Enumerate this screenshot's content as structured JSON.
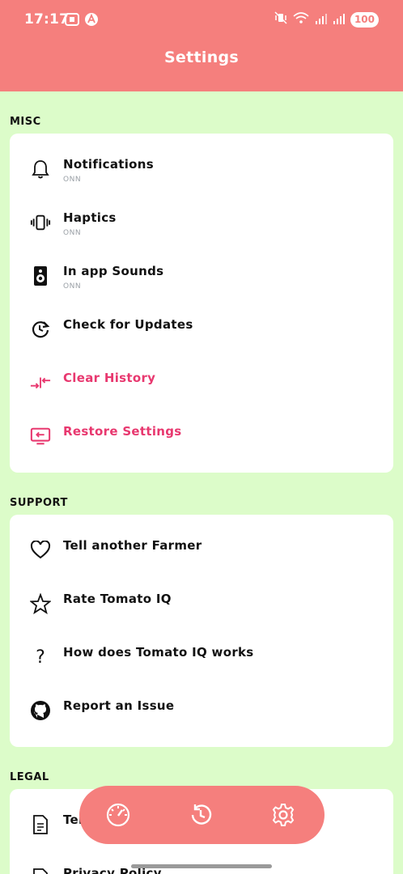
{
  "status_bar": {
    "time": "17:17",
    "battery": "100",
    "icons_left": [
      "screenshot-icon",
      "a-badge-icon"
    ],
    "icons_right": [
      "mute-vibrate-icon",
      "wifi-icon",
      "signal-icon",
      "signal-icon-2"
    ]
  },
  "header": {
    "title": "Settings",
    "background": "#f57f7d"
  },
  "sections": {
    "misc": {
      "label": "MISC",
      "items": [
        {
          "label": "Notifications",
          "sub": "ONN",
          "icon": "bell-icon"
        },
        {
          "label": "Haptics",
          "sub": "ONN",
          "icon": "vibration-icon"
        },
        {
          "label": "In app Sounds",
          "sub": "ONN",
          "icon": "speaker-icon"
        },
        {
          "label": "Check for Updates",
          "icon": "update-icon"
        },
        {
          "label": "Clear History",
          "icon": "compress-arrows-icon",
          "color": "#e8386f"
        },
        {
          "label": "Restore Settings",
          "icon": "restore-screen-icon",
          "color": "#e8386f"
        }
      ]
    },
    "support": {
      "label": "SUPPORT",
      "items": [
        {
          "label": "Tell another Farmer",
          "icon": "heart-icon"
        },
        {
          "label": "Rate Tomato IQ",
          "icon": "star-icon"
        },
        {
          "label": "How does Tomato IQ works",
          "icon": "question-icon"
        },
        {
          "label": "Report an Issue",
          "icon": "github-icon"
        }
      ]
    },
    "legal": {
      "label": "LEGAL",
      "items": [
        {
          "label": "Terms",
          "icon": "document-icon"
        },
        {
          "label": "Privacy Policy",
          "icon": "document-icon"
        }
      ]
    }
  },
  "bottom_nav": {
    "items": [
      {
        "icon": "speedometer-icon"
      },
      {
        "icon": "history-icon"
      },
      {
        "icon": "settings-gear-icon"
      }
    ]
  },
  "colors": {
    "background": "#dcfcc9",
    "accent": "#f57f7d",
    "destructive": "#e8386f"
  }
}
